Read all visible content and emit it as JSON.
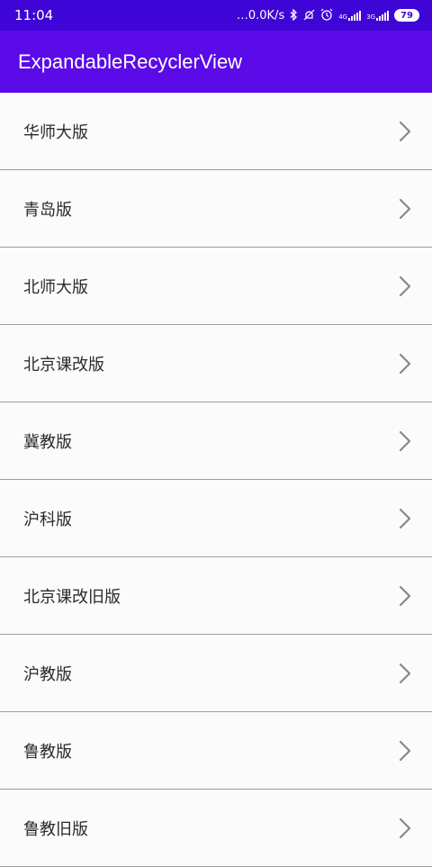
{
  "status_bar": {
    "time": "11:04",
    "network_speed": "…0.0K/s",
    "bluetooth_icon": "bluetooth-icon",
    "mute_icon": "mute-icon",
    "alarm_icon": "alarm-icon",
    "signal1_label": "4G",
    "signal2_label": "3G",
    "battery": "79"
  },
  "app_bar": {
    "title": "ExpandableRecyclerView"
  },
  "list": {
    "items": [
      {
        "label": "华师大版"
      },
      {
        "label": "青岛版"
      },
      {
        "label": "北师大版"
      },
      {
        "label": "北京课改版"
      },
      {
        "label": "冀教版"
      },
      {
        "label": "沪科版"
      },
      {
        "label": "北京课改旧版"
      },
      {
        "label": "沪教版"
      },
      {
        "label": "鲁教版"
      },
      {
        "label": "鲁教旧版"
      }
    ],
    "chevron_icon": "chevron-right-icon"
  },
  "colors": {
    "status_bar": "#3f05d6",
    "app_bar": "#5b0be8",
    "chevron": "#888888"
  }
}
